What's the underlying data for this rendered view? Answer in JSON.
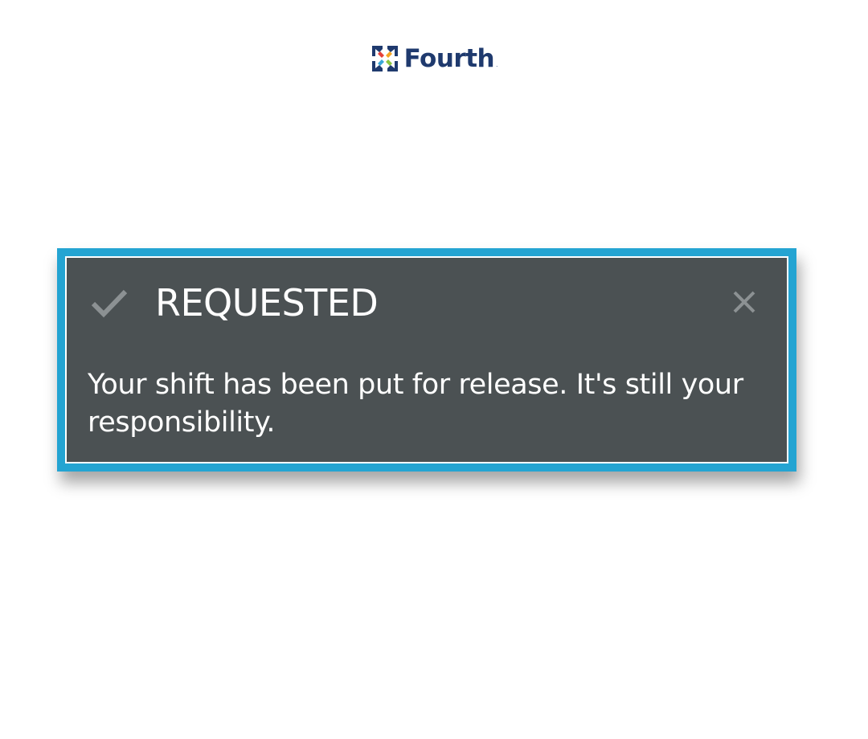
{
  "brand": {
    "name": "Fourth",
    "trademark": ".",
    "color": "#1f3a6e"
  },
  "toast": {
    "status_icon": "check-icon",
    "close_icon": "close-icon",
    "title": "REQUESTED",
    "message": "Your shift has been put for release. It's still your responsibility.",
    "colors": {
      "frame": "#24a4d2",
      "background": "#4b5153",
      "text": "#ffffff",
      "icon": "#8c9193"
    }
  }
}
